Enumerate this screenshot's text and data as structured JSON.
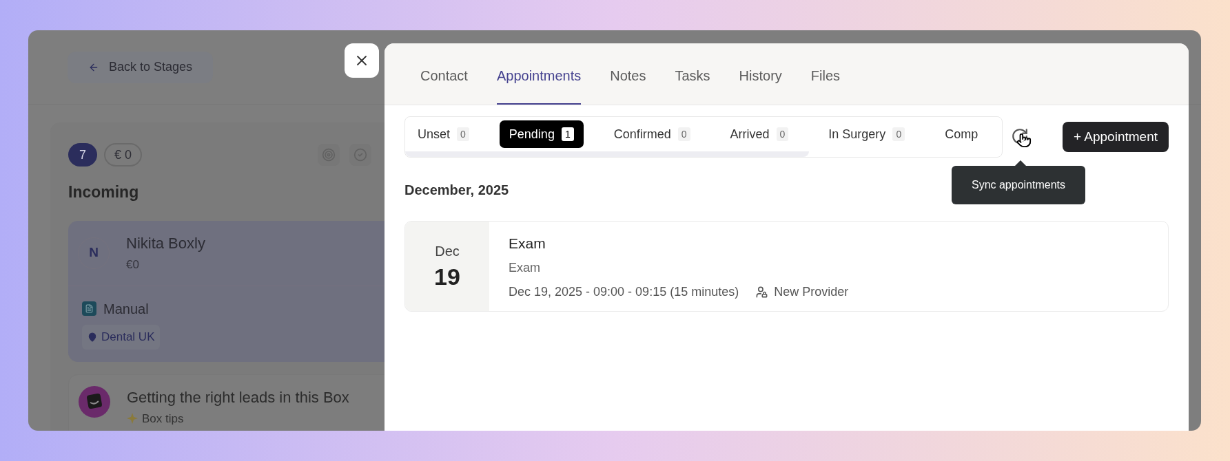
{
  "background_page": {
    "back_button": "Back to Stages",
    "count_badge": "7",
    "value_badge": "€ 0",
    "stage_title": "Incoming",
    "cards": [
      {
        "kind": "lead",
        "initial": "N",
        "name": "Nikita Boxly",
        "value": "€0",
        "source": "Manual",
        "location": "Dental UK"
      },
      {
        "kind": "tip",
        "title": "Getting the right leads in this Box",
        "subtitle": "Box tips"
      }
    ]
  },
  "drawer": {
    "tabs": [
      {
        "label": "Contact",
        "selected": false
      },
      {
        "label": "Appointments",
        "selected": true
      },
      {
        "label": "Notes",
        "selected": false
      },
      {
        "label": "Tasks",
        "selected": false
      },
      {
        "label": "History",
        "selected": false
      },
      {
        "label": "Files",
        "selected": false
      }
    ],
    "status_filters": [
      {
        "label": "Unset",
        "count": "0",
        "selected": false
      },
      {
        "label": "Pending",
        "count": "1",
        "selected": true
      },
      {
        "label": "Confirmed",
        "count": "0",
        "selected": false
      },
      {
        "label": "Arrived",
        "count": "0",
        "selected": false
      },
      {
        "label": "In Surgery",
        "count": "0",
        "selected": false
      },
      {
        "label": "Comp",
        "selected": false
      }
    ],
    "sync_tooltip": "Sync appointments",
    "add_button": "+ Appointment",
    "month_heading": "December, 2025",
    "appointments": [
      {
        "month": "Dec",
        "day": "19",
        "title": "Exam",
        "type": "Exam",
        "time": "Dec 19, 2025 - 09:00 - 09:15 (15 minutes)",
        "provider": "New Provider"
      }
    ]
  }
}
